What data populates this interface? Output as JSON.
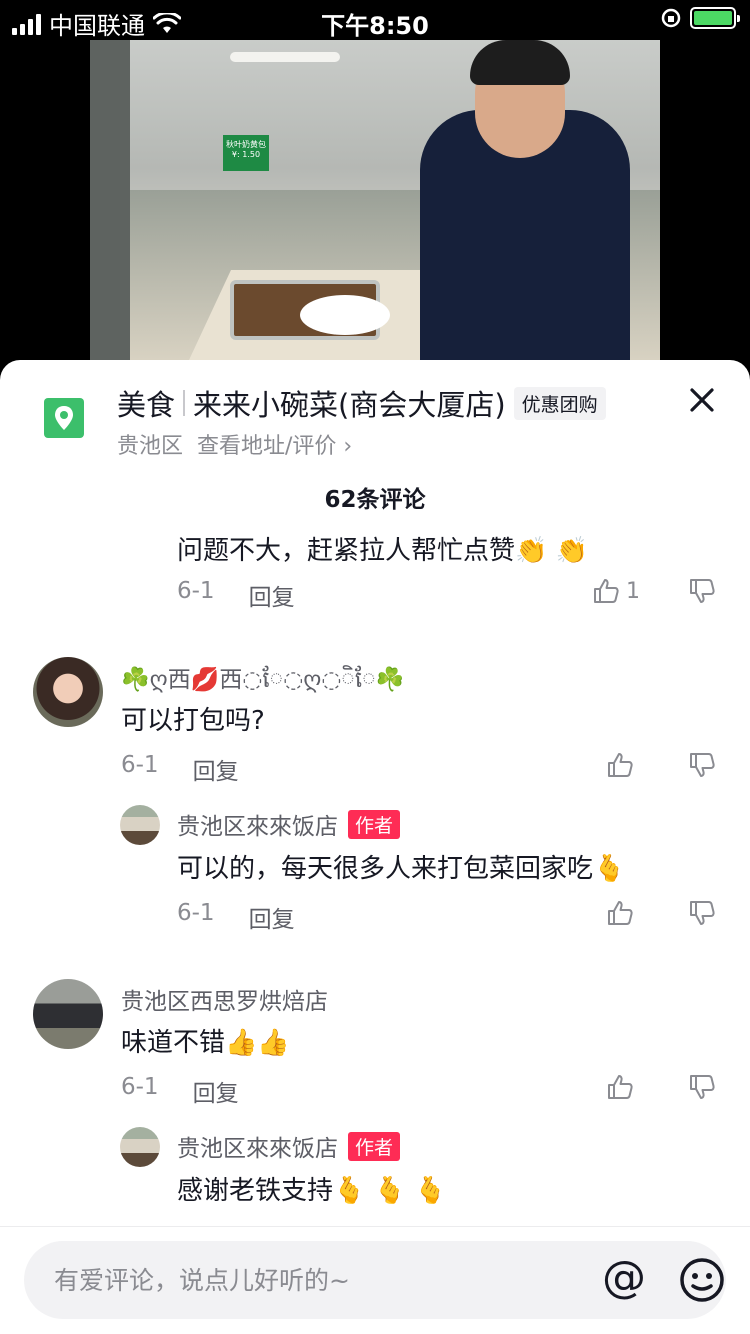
{
  "status_bar": {
    "carrier": "中国联通",
    "time": "下午8:50"
  },
  "video": {
    "sign_text": "秋叶奶黄包",
    "sign_price": "¥: 1.50"
  },
  "poi": {
    "category": "美食",
    "name": "来来小碗菜(商会大厦店)",
    "promo": "优惠团购",
    "district": "贵池区",
    "link": "查看地址/评价 ›"
  },
  "comments_header": "62条评论",
  "comments": [
    {
      "partial_text": "问题不大，赶紧拉人帮忙点赞👏 👏",
      "date": "6-1",
      "reply": "回复",
      "likes": "1"
    },
    {
      "user": "☘️ღ西💋西◌ែ◌ღ◌ិ◌ែ☘️",
      "text": "可以打包吗?",
      "date": "6-1",
      "reply": "回复",
      "sub_reply": {
        "user": "贵池区來來饭店",
        "tag": "作者",
        "text": "可以的，每天很多人来打包菜回家吃🫰",
        "date": "6-1",
        "reply": "回复"
      }
    },
    {
      "user": "贵池区西思罗烘焙店",
      "text": "味道不错👍👍",
      "date": "6-1",
      "reply": "回复",
      "sub_reply": {
        "user": "贵池区來來饭店",
        "tag": "作者",
        "text": "感谢老铁支持🫰 🫰 🫰"
      }
    }
  ],
  "input": {
    "placeholder": "有爱评论，说点儿好听的~",
    "at_symbol": "@"
  },
  "colors": {
    "accent_pin": "#3cbf6b",
    "author_tag": "#fe2c55",
    "secondary_text": "#8a8b91"
  },
  "icons": [
    "location-pin-icon",
    "close-icon",
    "thumb-up-icon",
    "thumb-down-icon",
    "emoji-icon",
    "wifi-icon",
    "battery-icon"
  ]
}
